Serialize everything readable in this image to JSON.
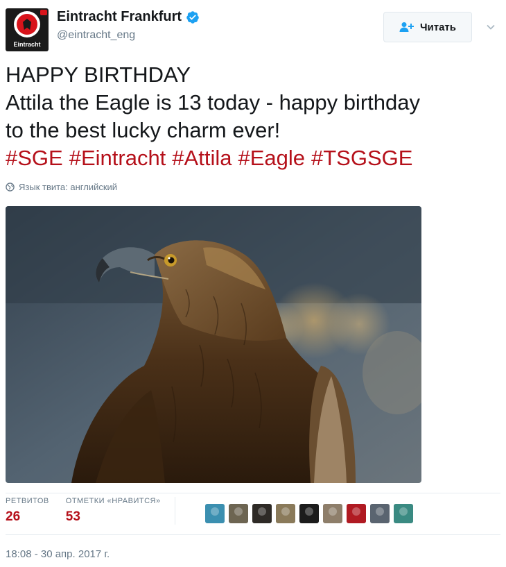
{
  "account": {
    "name": "Eintracht Frankfurt",
    "handle": "@eintracht_eng",
    "avatar_text": "Eintracht",
    "verified": true,
    "brand_color": "#d8141b"
  },
  "follow_button": {
    "label": "Читать",
    "icon": "add-user-icon"
  },
  "tweet": {
    "lines": [
      "HAPPY BIRTHDAY",
      "Attila the Eagle is 13 today - happy birthday",
      "to the best lucky charm ever!"
    ],
    "hashtags": [
      "#SGE",
      "#Eintracht",
      "#Attila",
      "#Eagle",
      "#TSGSGE"
    ],
    "hashtag_color": "#b5101a"
  },
  "language_note": "Язык твита: английский",
  "stats": {
    "retweets_label": "РЕТВИТОВ",
    "retweets": "26",
    "likes_label": "ОТМЕТКИ «НРАВИТСЯ»",
    "likes": "53"
  },
  "liker_avatars": [
    {
      "color": "#3b8fb0"
    },
    {
      "color": "#6d6552"
    },
    {
      "color": "#2e2a26"
    },
    {
      "color": "#8a7a5a"
    },
    {
      "color": "#1c1c1c"
    },
    {
      "color": "#8e7e6a"
    },
    {
      "color": "#b01a22"
    },
    {
      "color": "#5a6470"
    },
    {
      "color": "#3a8a82"
    }
  ],
  "timestamp": "18:08 - 30 апр. 2017 г."
}
